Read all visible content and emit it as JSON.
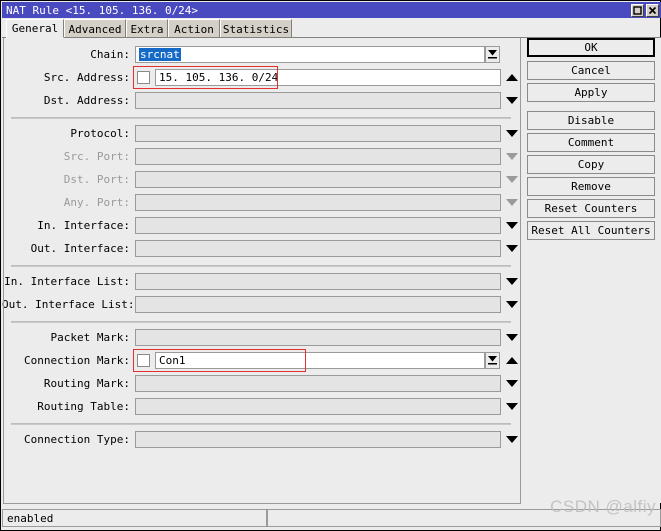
{
  "window": {
    "title": "NAT Rule <15. 105. 136. 0/24>",
    "controls": [
      {
        "name": "maximize-button",
        "icon": "maximize-icon"
      },
      {
        "name": "close-button",
        "icon": "close-icon"
      }
    ]
  },
  "tabs": [
    {
      "label": "General",
      "active": true
    },
    {
      "label": "Advanced",
      "active": false
    },
    {
      "label": "Extra",
      "active": false
    },
    {
      "label": "Action",
      "active": false
    },
    {
      "label": "Statistics",
      "active": false
    }
  ],
  "form": {
    "fields": [
      {
        "label": "Chain:",
        "value": "srcnat",
        "selected": true,
        "dim": false,
        "checkbox": false,
        "combo": true,
        "arrow": "none",
        "highlight": false
      },
      {
        "label": "Src. Address:",
        "value": "15. 105. 136. 0/24",
        "selected": false,
        "dim": false,
        "checkbox": true,
        "combo": false,
        "arrow": "up",
        "highlight": true
      },
      {
        "label": "Dst. Address:",
        "value": "",
        "selected": false,
        "dim": false,
        "checkbox": false,
        "combo": false,
        "arrow": "down",
        "highlight": false
      },
      {
        "label": "Protocol:",
        "value": "",
        "selected": false,
        "dim": false,
        "checkbox": false,
        "combo": false,
        "arrow": "down",
        "highlight": false
      },
      {
        "label": "Src. Port:",
        "value": "",
        "selected": false,
        "dim": true,
        "checkbox": false,
        "combo": false,
        "arrow": "down-dim",
        "highlight": false
      },
      {
        "label": "Dst. Port:",
        "value": "",
        "selected": false,
        "dim": true,
        "checkbox": false,
        "combo": false,
        "arrow": "down-dim",
        "highlight": false
      },
      {
        "label": "Any. Port:",
        "value": "",
        "selected": false,
        "dim": true,
        "checkbox": false,
        "combo": false,
        "arrow": "down-dim",
        "highlight": false
      },
      {
        "label": "In. Interface:",
        "value": "",
        "selected": false,
        "dim": false,
        "checkbox": false,
        "combo": false,
        "arrow": "down",
        "highlight": false
      },
      {
        "label": "Out. Interface:",
        "value": "",
        "selected": false,
        "dim": false,
        "checkbox": false,
        "combo": false,
        "arrow": "down",
        "highlight": false
      },
      {
        "label": "In. Interface List:",
        "value": "",
        "selected": false,
        "dim": false,
        "checkbox": false,
        "combo": false,
        "arrow": "down",
        "highlight": false
      },
      {
        "label": "Out. Interface List:",
        "value": "",
        "selected": false,
        "dim": false,
        "checkbox": false,
        "combo": false,
        "arrow": "down",
        "highlight": false
      },
      {
        "label": "Packet Mark:",
        "value": "",
        "selected": false,
        "dim": false,
        "checkbox": false,
        "combo": false,
        "arrow": "down",
        "highlight": false
      },
      {
        "label": "Connection Mark:",
        "value": "Con1",
        "selected": false,
        "dim": false,
        "checkbox": true,
        "combo": true,
        "arrow": "up",
        "highlight": true
      },
      {
        "label": "Routing Mark:",
        "value": "",
        "selected": false,
        "dim": false,
        "checkbox": false,
        "combo": false,
        "arrow": "down",
        "highlight": false
      },
      {
        "label": "Routing Table:",
        "value": "",
        "selected": false,
        "dim": false,
        "checkbox": false,
        "combo": false,
        "arrow": "down",
        "highlight": false
      },
      {
        "label": "Connection Type:",
        "value": "",
        "selected": false,
        "dim": false,
        "checkbox": false,
        "combo": false,
        "arrow": "down",
        "highlight": false
      }
    ]
  },
  "buttons": [
    {
      "label": "OK",
      "default": true
    },
    {
      "label": "Cancel",
      "default": false
    },
    {
      "label": "Apply",
      "default": false
    },
    {
      "label": "Disable",
      "default": false
    },
    {
      "label": "Comment",
      "default": false
    },
    {
      "label": "Copy",
      "default": false
    },
    {
      "label": "Remove",
      "default": false
    },
    {
      "label": "Reset Counters",
      "default": false
    },
    {
      "label": "Reset All Counters",
      "default": false
    }
  ],
  "statusbar": {
    "state": "enabled",
    "second": ""
  },
  "watermark": "CSDN @alfiy",
  "colors": {
    "titlebar": "#4a4ac0",
    "face": "#ececec",
    "highlight_box": "#e03030",
    "selection": "#1569c7"
  }
}
